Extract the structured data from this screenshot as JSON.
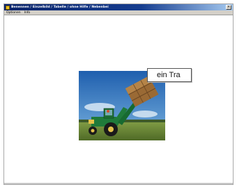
{
  "window": {
    "title": "Benennen / Einzelbild / Tabelle / ohne Hilfe / Nebenbei",
    "close_glyph": "×"
  },
  "menu": {
    "items": [
      "Optionen",
      "Info"
    ]
  },
  "photo": {
    "subject": "green tractor with front loader lifting hay bales",
    "colors": {
      "sky": "#2f7fc4",
      "field": "#6a8a3a",
      "tractor": "#1f7a3a",
      "hay": "#a0703a"
    }
  },
  "word_box": {
    "text": "ein Tra"
  }
}
